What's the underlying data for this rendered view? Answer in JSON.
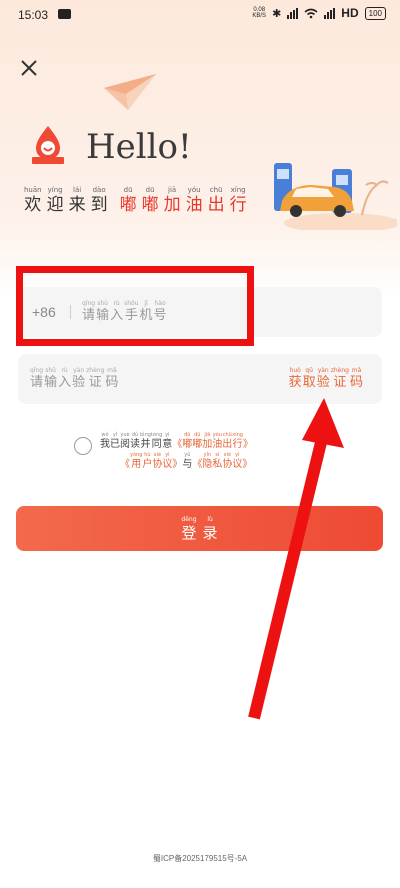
{
  "status_bar": {
    "time": "15:03",
    "net_speed_value": "0.08",
    "net_speed_unit": "KB/S",
    "network_type": "HD",
    "battery": "100"
  },
  "header": {
    "hello": "Hello!",
    "welcome": [
      {
        "py": "huān",
        "hz": "欢"
      },
      {
        "py": "yíng",
        "hz": "迎"
      },
      {
        "py": "lái",
        "hz": "来"
      },
      {
        "py": "dào",
        "hz": "到"
      }
    ],
    "brand": [
      {
        "py": "dū",
        "hz": "嘟"
      },
      {
        "py": "dū",
        "hz": "嘟"
      },
      {
        "py": "jiā",
        "hz": "加"
      },
      {
        "py": "yóu",
        "hz": "油"
      },
      {
        "py": "chū",
        "hz": "出"
      },
      {
        "py": "xíng",
        "hz": "行"
      }
    ],
    "logo_text": "嘟嘟加油"
  },
  "phone_field": {
    "country_code": "+86",
    "placeholder": [
      {
        "py": "qǐng",
        "hz": "请"
      },
      {
        "py": "shū",
        "hz": "输"
      },
      {
        "py": "rù",
        "hz": "入"
      },
      {
        "py": "shǒu",
        "hz": "手"
      },
      {
        "py": "jī",
        "hz": "机"
      },
      {
        "py": "hào",
        "hz": "号"
      }
    ]
  },
  "code_field": {
    "placeholder": [
      {
        "py": "qǐng",
        "hz": "请"
      },
      {
        "py": "shū",
        "hz": "输"
      },
      {
        "py": "rù",
        "hz": "入"
      },
      {
        "py": "yàn",
        "hz": "验"
      },
      {
        "py": "zhèng",
        "hz": "证"
      },
      {
        "py": "mǎ",
        "hz": "码"
      }
    ],
    "get_code": [
      {
        "py": "huò",
        "hz": "获"
      },
      {
        "py": "qǔ",
        "hz": "取"
      },
      {
        "py": "yàn",
        "hz": "验"
      },
      {
        "py": "zhèng",
        "hz": "证"
      },
      {
        "py": "mǎ",
        "hz": "码"
      }
    ]
  },
  "agreement": {
    "prefix": [
      {
        "py": "wǒ",
        "hz": "我"
      },
      {
        "py": "yǐ",
        "hz": "已"
      },
      {
        "py": "yuè",
        "hz": "阅"
      },
      {
        "py": "dú",
        "hz": "读"
      },
      {
        "py": "bìng",
        "hz": "并"
      },
      {
        "py": "tóng",
        "hz": "同"
      },
      {
        "py": "yì",
        "hz": "意"
      }
    ],
    "brand_quote": [
      {
        "py": "",
        "hz": "《"
      },
      {
        "py": "dū",
        "hz": "嘟"
      },
      {
        "py": "dū",
        "hz": "嘟"
      },
      {
        "py": "jiā",
        "hz": "加"
      },
      {
        "py": "yóu",
        "hz": "油"
      },
      {
        "py": "chū",
        "hz": "出"
      },
      {
        "py": "xíng",
        "hz": "行"
      },
      {
        "py": "",
        "hz": "》"
      }
    ],
    "user_agreement": [
      {
        "py": "",
        "hz": "《"
      },
      {
        "py": "yòng",
        "hz": "用"
      },
      {
        "py": "hù",
        "hz": "户"
      },
      {
        "py": "xié",
        "hz": "协"
      },
      {
        "py": "yì",
        "hz": "议"
      },
      {
        "py": "",
        "hz": "》"
      }
    ],
    "and": {
      "py": "yǔ",
      "hz": "与"
    },
    "privacy_agreement": [
      {
        "py": "",
        "hz": "《"
      },
      {
        "py": "yǐn",
        "hz": "隐"
      },
      {
        "py": "sī",
        "hz": "私"
      },
      {
        "py": "xié",
        "hz": "协"
      },
      {
        "py": "yì",
        "hz": "议"
      },
      {
        "py": "",
        "hz": "》"
      }
    ]
  },
  "login_button": [
    {
      "py": "dēng",
      "hz": "登"
    },
    {
      "py": "lù",
      "hz": "录"
    }
  ],
  "footer": {
    "icp": "蜀ICP备2025179515号-5A"
  },
  "colors": {
    "accent": "#ee4a34",
    "link": "#e8683a",
    "overlay_red": "#ee1111"
  }
}
